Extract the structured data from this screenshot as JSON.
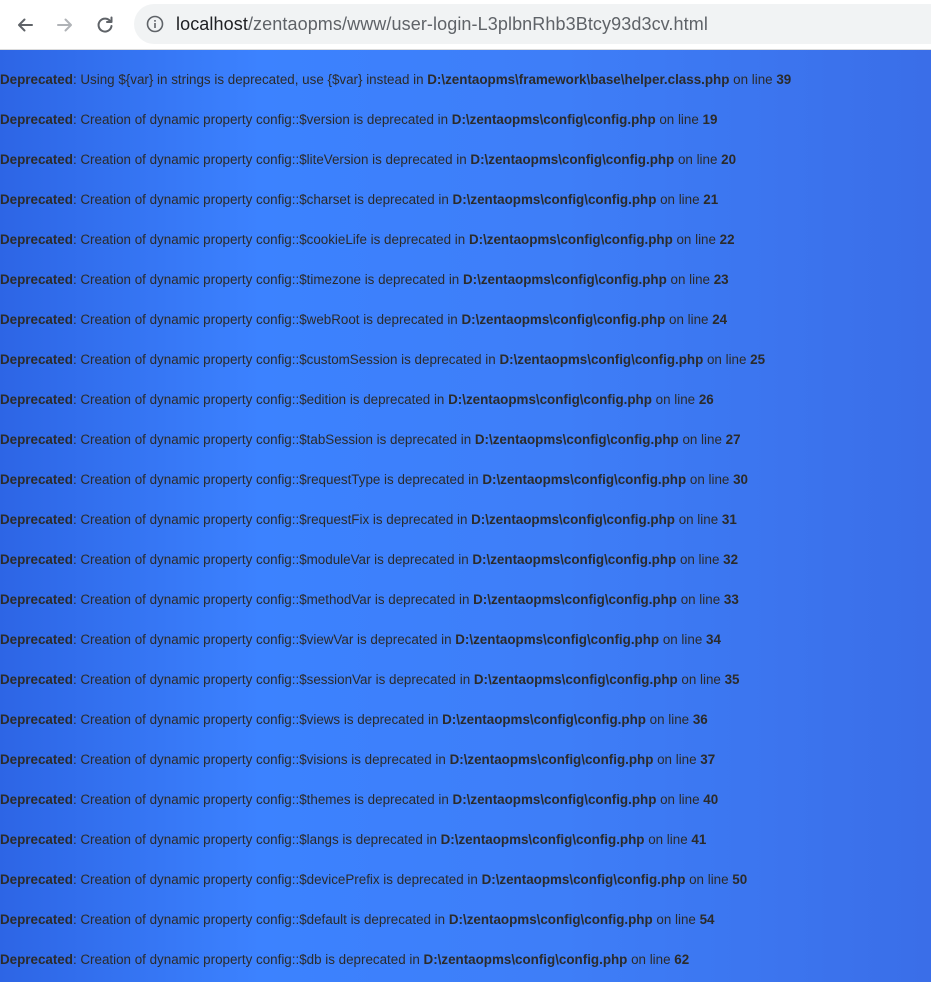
{
  "browser": {
    "url_host": "localhost",
    "url_path": "/zentaopms/www/user-login-L3plbnRhb3Btcy93d3cv.html",
    "icons": {
      "back": "arrow-left-icon",
      "forward": "arrow-right-icon",
      "reload": "reload-icon",
      "info": "info-icon"
    }
  },
  "messages": [
    {
      "label": "Deprecated",
      "text": ": Using ${var} in strings is deprecated, use {$var} instead in ",
      "file": "D:\\zentaopms\\framework\\base\\helper.class.php",
      "on_line": " on line ",
      "line": "39"
    },
    {
      "label": "Deprecated",
      "text": ": Creation of dynamic property config::$version is deprecated in ",
      "file": "D:\\zentaopms\\config\\config.php",
      "on_line": " on line ",
      "line": "19"
    },
    {
      "label": "Deprecated",
      "text": ": Creation of dynamic property config::$liteVersion is deprecated in ",
      "file": "D:\\zentaopms\\config\\config.php",
      "on_line": " on line ",
      "line": "20"
    },
    {
      "label": "Deprecated",
      "text": ": Creation of dynamic property config::$charset is deprecated in ",
      "file": "D:\\zentaopms\\config\\config.php",
      "on_line": " on line ",
      "line": "21"
    },
    {
      "label": "Deprecated",
      "text": ": Creation of dynamic property config::$cookieLife is deprecated in ",
      "file": "D:\\zentaopms\\config\\config.php",
      "on_line": " on line ",
      "line": "22"
    },
    {
      "label": "Deprecated",
      "text": ": Creation of dynamic property config::$timezone is deprecated in ",
      "file": "D:\\zentaopms\\config\\config.php",
      "on_line": " on line ",
      "line": "23"
    },
    {
      "label": "Deprecated",
      "text": ": Creation of dynamic property config::$webRoot is deprecated in ",
      "file": "D:\\zentaopms\\config\\config.php",
      "on_line": " on line ",
      "line": "24"
    },
    {
      "label": "Deprecated",
      "text": ": Creation of dynamic property config::$customSession is deprecated in ",
      "file": "D:\\zentaopms\\config\\config.php",
      "on_line": " on line ",
      "line": "25"
    },
    {
      "label": "Deprecated",
      "text": ": Creation of dynamic property config::$edition is deprecated in ",
      "file": "D:\\zentaopms\\config\\config.php",
      "on_line": " on line ",
      "line": "26"
    },
    {
      "label": "Deprecated",
      "text": ": Creation of dynamic property config::$tabSession is deprecated in ",
      "file": "D:\\zentaopms\\config\\config.php",
      "on_line": " on line ",
      "line": "27"
    },
    {
      "label": "Deprecated",
      "text": ": Creation of dynamic property config::$requestType is deprecated in ",
      "file": "D:\\zentaopms\\config\\config.php",
      "on_line": " on line ",
      "line": "30"
    },
    {
      "label": "Deprecated",
      "text": ": Creation of dynamic property config::$requestFix is deprecated in ",
      "file": "D:\\zentaopms\\config\\config.php",
      "on_line": " on line ",
      "line": "31"
    },
    {
      "label": "Deprecated",
      "text": ": Creation of dynamic property config::$moduleVar is deprecated in ",
      "file": "D:\\zentaopms\\config\\config.php",
      "on_line": " on line ",
      "line": "32"
    },
    {
      "label": "Deprecated",
      "text": ": Creation of dynamic property config::$methodVar is deprecated in ",
      "file": "D:\\zentaopms\\config\\config.php",
      "on_line": " on line ",
      "line": "33"
    },
    {
      "label": "Deprecated",
      "text": ": Creation of dynamic property config::$viewVar is deprecated in ",
      "file": "D:\\zentaopms\\config\\config.php",
      "on_line": " on line ",
      "line": "34"
    },
    {
      "label": "Deprecated",
      "text": ": Creation of dynamic property config::$sessionVar is deprecated in ",
      "file": "D:\\zentaopms\\config\\config.php",
      "on_line": " on line ",
      "line": "35"
    },
    {
      "label": "Deprecated",
      "text": ": Creation of dynamic property config::$views is deprecated in ",
      "file": "D:\\zentaopms\\config\\config.php",
      "on_line": " on line ",
      "line": "36"
    },
    {
      "label": "Deprecated",
      "text": ": Creation of dynamic property config::$visions is deprecated in ",
      "file": "D:\\zentaopms\\config\\config.php",
      "on_line": " on line ",
      "line": "37"
    },
    {
      "label": "Deprecated",
      "text": ": Creation of dynamic property config::$themes is deprecated in ",
      "file": "D:\\zentaopms\\config\\config.php",
      "on_line": " on line ",
      "line": "40"
    },
    {
      "label": "Deprecated",
      "text": ": Creation of dynamic property config::$langs is deprecated in ",
      "file": "D:\\zentaopms\\config\\config.php",
      "on_line": " on line ",
      "line": "41"
    },
    {
      "label": "Deprecated",
      "text": ": Creation of dynamic property config::$devicePrefix is deprecated in ",
      "file": "D:\\zentaopms\\config\\config.php",
      "on_line": " on line ",
      "line": "50"
    },
    {
      "label": "Deprecated",
      "text": ": Creation of dynamic property config::$default is deprecated in ",
      "file": "D:\\zentaopms\\config\\config.php",
      "on_line": " on line ",
      "line": "54"
    },
    {
      "label": "Deprecated",
      "text": ": Creation of dynamic property config::$db is deprecated in ",
      "file": "D:\\zentaopms\\config\\config.php",
      "on_line": " on line ",
      "line": "62"
    }
  ]
}
